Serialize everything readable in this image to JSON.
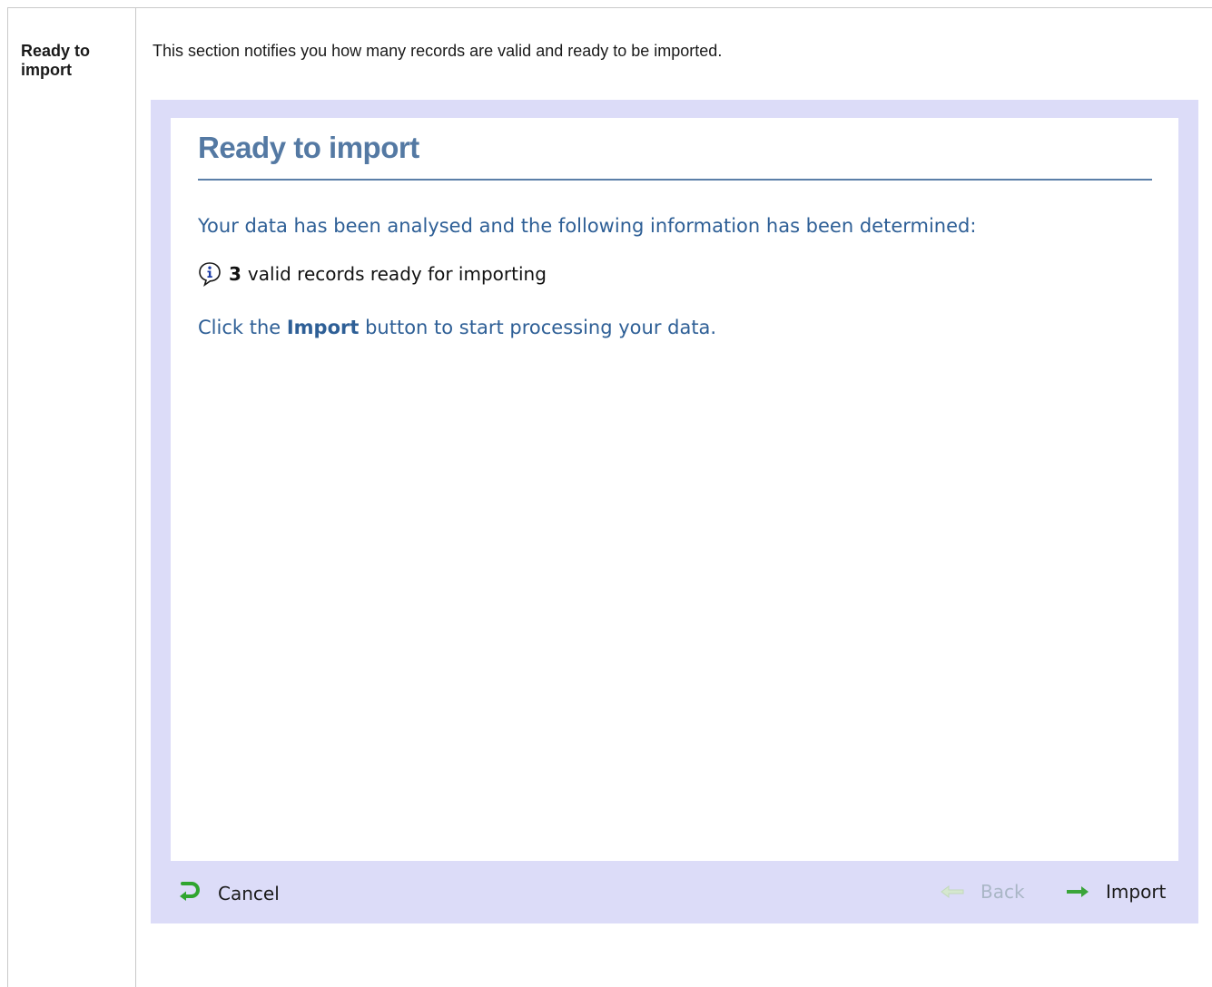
{
  "section": {
    "heading": "Ready to import",
    "description": "This section notifies you how many records are valid and ready to be imported."
  },
  "wizard": {
    "title": "Ready to import",
    "intro": "Your data has been analysed and the following information has been determined:",
    "info": {
      "icon": "info-icon",
      "count": "3",
      "text": "valid records ready for importing"
    },
    "hint": {
      "prefix": "Click the ",
      "emphasis": "Import",
      "suffix": " button to start processing your data."
    },
    "footer": {
      "cancel_label": "Cancel",
      "back_label": "Back",
      "import_label": "Import"
    },
    "colors": {
      "frame": "#dcdcf8",
      "title": "#5479a3",
      "text": "#2e5f96",
      "cancel_icon": "#2fa52f",
      "import_icon": "#3aa53a",
      "back_disabled": "#a9b6c5"
    }
  }
}
